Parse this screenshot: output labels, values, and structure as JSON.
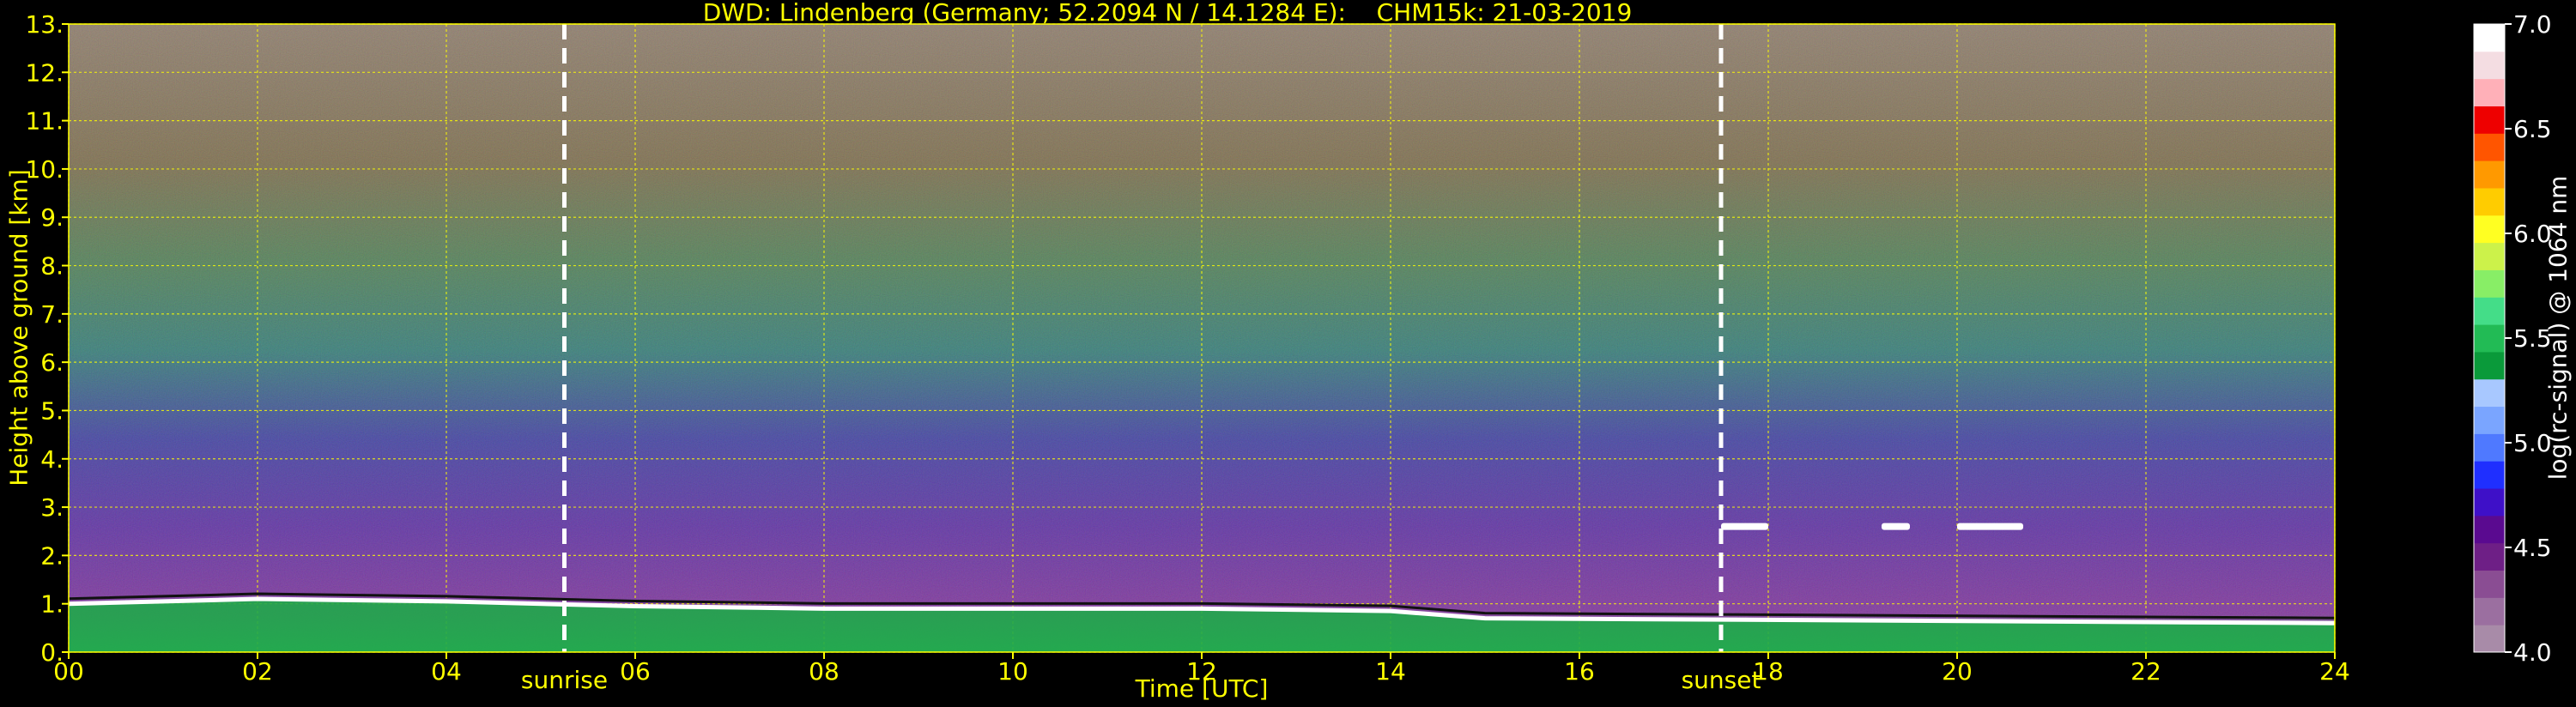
{
  "chart_data": {
    "type": "heatmap",
    "title": "DWD: Lindenberg (Germany; 52.2094 N / 14.1284 E):    CHM15k: 21-03-2019",
    "xlabel": "Time [UTC]",
    "ylabel": "Height above ground [km]",
    "xlim": [
      0,
      24
    ],
    "ylim": [
      0,
      13
    ],
    "x_ticks": [
      "00",
      "02",
      "04",
      "06",
      "08",
      "10",
      "12",
      "14",
      "16",
      "18",
      "20",
      "22",
      "24"
    ],
    "y_ticks": [
      "0.",
      "1.",
      "2.",
      "3.",
      "4.",
      "5.",
      "6.",
      "7.",
      "8.",
      "9.",
      "10.",
      "11.",
      "12.",
      "13."
    ],
    "grid": true,
    "events": [
      {
        "label": "sunrise",
        "time": 5.25
      },
      {
        "label": "sunset",
        "time": 17.5
      }
    ],
    "boundary_layer_top_km": [
      {
        "time": 0,
        "height": 1.0
      },
      {
        "time": 2,
        "height": 1.1
      },
      {
        "time": 4,
        "height": 1.05
      },
      {
        "time": 6,
        "height": 0.95
      },
      {
        "time": 8,
        "height": 0.9
      },
      {
        "time": 10,
        "height": 0.9
      },
      {
        "time": 12,
        "height": 0.9
      },
      {
        "time": 14,
        "height": 0.85
      },
      {
        "time": 15,
        "height": 0.7
      },
      {
        "time": 24,
        "height": 0.6
      }
    ],
    "cloud_segments_km": [
      {
        "start": 17.5,
        "end": 18.0,
        "height": 2.6
      },
      {
        "start": 19.2,
        "end": 19.5,
        "height": 2.6
      },
      {
        "start": 20.0,
        "end": 20.7,
        "height": 2.6
      }
    ],
    "colorbar": {
      "label": "log(rc-signal) @ 1064 nm",
      "min": 4.0,
      "max": 7.0,
      "tick_labels": [
        "4.0",
        "4.5",
        "5.0",
        "5.5",
        "6.0",
        "6.5",
        "7.0"
      ],
      "colors": [
        "#a88ba8",
        "#9b6fa0",
        "#8a4d93",
        "#6e1f86",
        "#5a0a90",
        "#3e10c8",
        "#1f2fff",
        "#4f79ff",
        "#7aa5ff",
        "#a8c8ff",
        "#0a9a3a",
        "#22bb55",
        "#44dd88",
        "#88ee66",
        "#ccf24a",
        "#ffff22",
        "#ffcc00",
        "#ff9900",
        "#ff5500",
        "#ee0000",
        "#ffb0b8",
        "#f4dde2",
        "#ffffff"
      ]
    }
  }
}
